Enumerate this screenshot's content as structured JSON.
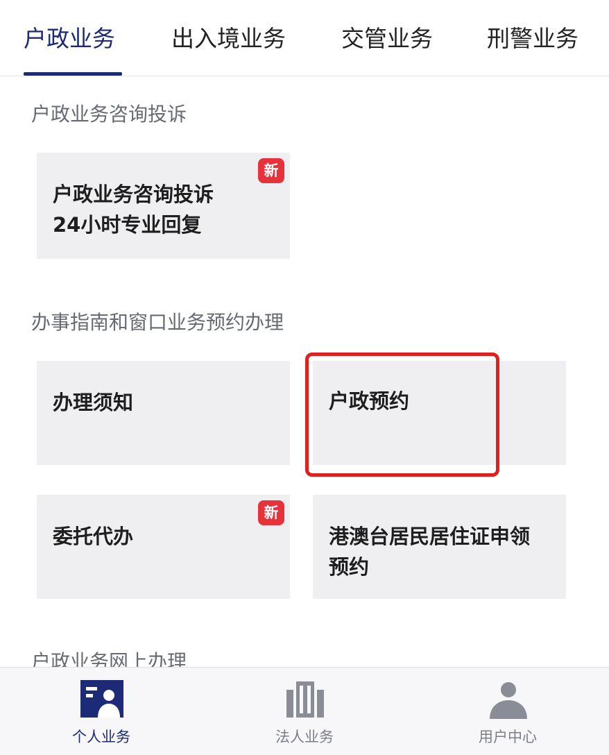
{
  "tabs": [
    {
      "label": "户政业务",
      "active": true
    },
    {
      "label": "出入境业务",
      "active": false
    },
    {
      "label": "交管业务",
      "active": false
    },
    {
      "label": "刑警业务",
      "active": false
    }
  ],
  "sections": {
    "consult": {
      "title": "户政业务咨询投诉",
      "card": {
        "line1": "户政业务咨询投诉",
        "line2": "24小时专业回复",
        "badge": "新"
      }
    },
    "guide": {
      "title": "办事指南和窗口业务预约办理",
      "cards": [
        {
          "label": "办理须知"
        },
        {
          "label": "户政预约"
        },
        {
          "label": "委托代办",
          "badge": "新"
        },
        {
          "line1": "港澳台居民居住证申领",
          "line2": "预约"
        }
      ]
    },
    "online": {
      "title": "户政业务网上办理"
    }
  },
  "bottom_nav": [
    {
      "label": "个人业务",
      "icon": "personal-business-icon",
      "active": true
    },
    {
      "label": "法人业务",
      "icon": "building-icon",
      "active": false
    },
    {
      "label": "用户中心",
      "icon": "user-icon",
      "active": false
    }
  ],
  "colors": {
    "accent": "#1c2a78",
    "badge": "#e5323b",
    "highlight": "#e0201e",
    "card_bg": "#efeff2",
    "nav_inactive": "#8a8d95"
  }
}
